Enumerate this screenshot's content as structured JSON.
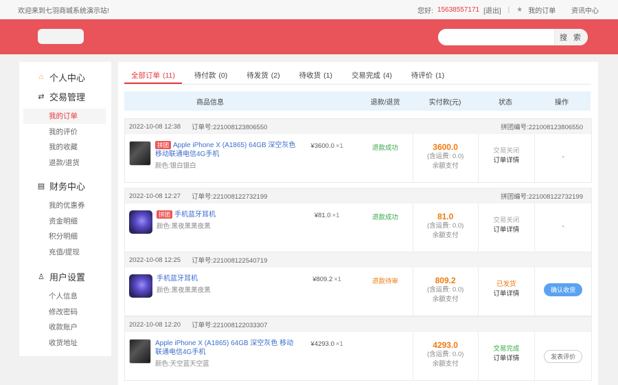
{
  "topbar": {
    "welcome": "欢迎来到七羽商城系统演示站!",
    "greeting": "您好:",
    "phone": "15638557171",
    "logout": "[退出]",
    "my_orders": "我的订单",
    "news": "资讯中心"
  },
  "header": {
    "logo_text": "",
    "search_button": "搜 索",
    "search_value": ""
  },
  "sidebar": {
    "groups": [
      {
        "title": "个人中心",
        "icon": "home-icon",
        "items": []
      },
      {
        "title": "交易管理",
        "icon": "exchange-icon",
        "items": [
          "我的订单",
          "我的评价",
          "我的收藏",
          "退款/退货"
        ]
      },
      {
        "title": "财务中心",
        "icon": "finance-icon",
        "items": [
          "我的优惠券",
          "资金明细",
          "积分明细",
          "充值/提现"
        ]
      },
      {
        "title": "用户设置",
        "icon": "user-icon",
        "items": [
          "个人信息",
          "修改密码",
          "收款账户",
          "收货地址"
        ]
      }
    ],
    "active_item": "我的订单"
  },
  "tabs": [
    {
      "label": "全部订单",
      "count": "(11)",
      "active": true
    },
    {
      "label": "待付款",
      "count": "(0)",
      "active": false
    },
    {
      "label": "待发货",
      "count": "(2)",
      "active": false
    },
    {
      "label": "待收货",
      "count": "(1)",
      "active": false
    },
    {
      "label": "交易完成",
      "count": "(4)",
      "active": false
    },
    {
      "label": "待评价",
      "count": "(1)",
      "active": false
    }
  ],
  "table_headers": [
    "商品信息",
    "退款/退货",
    "实付款(元)",
    "状态",
    "操作"
  ],
  "orders": [
    {
      "date": "2022-10-08 12:38",
      "order_no_label": "订单号:",
      "order_no": "221008123806550",
      "group_label": "拼团编号:",
      "group_no": "221008123806550",
      "tag": "拼团",
      "product_name": "Apple iPhone X (A1865) 64GB 深空灰色 移动联通电信4G手机",
      "color": "颜色:银白银白",
      "price": "¥3600.0",
      "qty": "×1",
      "refund": "退款成功",
      "refund_color": "green",
      "amount": "3600.0",
      "shipping": "(含运费: 0.0)",
      "pay_method": "余额支付",
      "status": "交易关闭",
      "status_style": "gray",
      "detail": "订单详情",
      "op": "-",
      "thumb": "phone"
    },
    {
      "date": "2022-10-08 12:27",
      "order_no_label": "订单号:",
      "order_no": "221008122732199",
      "group_label": "拼团编号:",
      "group_no": "221008122732199",
      "tag": "拼团",
      "product_name": "手机蓝牙耳机",
      "color": "颜色:黑夜黑黑夜黑",
      "price": "¥81.0",
      "qty": "×1",
      "refund": "退款成功",
      "refund_color": "green",
      "amount": "81.0",
      "shipping": "(含运费: 0.0)",
      "pay_method": "余额支付",
      "status": "交易关闭",
      "status_style": "gray",
      "detail": "订单详情",
      "op": "-",
      "thumb": "ear"
    },
    {
      "date": "2022-10-08 12:25",
      "order_no_label": "订单号:",
      "order_no": "221008122540719",
      "group_label": "",
      "group_no": "",
      "tag": "",
      "product_name": "手机蓝牙耳机",
      "color": "颜色:黑夜黑黑夜黑",
      "price": "¥809.2",
      "qty": "×1",
      "refund": "退款待审",
      "refund_color": "orange",
      "amount": "809.2",
      "shipping": "(含运费: 0.0)",
      "pay_method": "余额支付",
      "status": "已发货",
      "status_style": "orange",
      "detail": "订单详情",
      "op": "确认收货",
      "thumb": "ear"
    },
    {
      "date": "2022-10-08 12:20",
      "order_no_label": "订单号:",
      "order_no": "221008122033307",
      "group_label": "",
      "group_no": "",
      "tag": "",
      "product_name": "Apple iPhone X (A1865) 64GB 深空灰色 移动联通电信4G手机",
      "color": "颜色:天空蓝天空蓝",
      "price": "¥4293.0",
      "qty": "×1",
      "refund": "",
      "refund_color": "",
      "amount": "4293.0",
      "shipping": "(含运费: 0.0)",
      "pay_method": "余额支付",
      "status": "交易完成",
      "status_style": "green",
      "detail": "订单详情",
      "op": "发表评价",
      "thumb": "phone"
    }
  ]
}
